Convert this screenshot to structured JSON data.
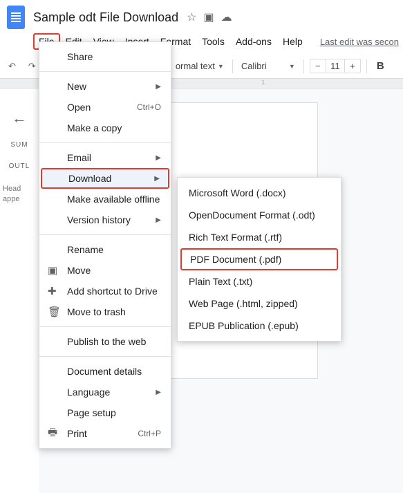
{
  "header": {
    "title": "Sample odt File Download",
    "last_edit": "Last edit was secon"
  },
  "menubar": {
    "file": "File",
    "edit": "Edit",
    "view": "View",
    "insert": "Insert",
    "format": "Format",
    "tools": "Tools",
    "addons": "Add-ons",
    "help": "Help"
  },
  "toolbar": {
    "style": "ormal text",
    "font": "Calibri",
    "size": "11"
  },
  "sidebar": {
    "summary": "SUM",
    "outline": "OUTL",
    "headings_hint": "Head\nappe"
  },
  "file_menu": {
    "share": "Share",
    "new": "New",
    "open": "Open",
    "open_short": "Ctrl+O",
    "make_copy": "Make a copy",
    "email": "Email",
    "download": "Download",
    "make_offline": "Make available offline",
    "version_history": "Version history",
    "rename": "Rename",
    "move": "Move",
    "add_shortcut": "Add shortcut to Drive",
    "trash": "Move to trash",
    "publish": "Publish to the web",
    "details": "Document details",
    "language": "Language",
    "page_setup": "Page setup",
    "print": "Print",
    "print_short": "Ctrl+P"
  },
  "download_submenu": {
    "docx": "Microsoft Word (.docx)",
    "odt": "OpenDocument Format (.odt)",
    "rtf": "Rich Text Format (.rtf)",
    "pdf": "PDF Document (.pdf)",
    "txt": "Plain Text (.txt)",
    "html": "Web Page (.html, zipped)",
    "epub": "EPUB Publication (.epub)"
  }
}
